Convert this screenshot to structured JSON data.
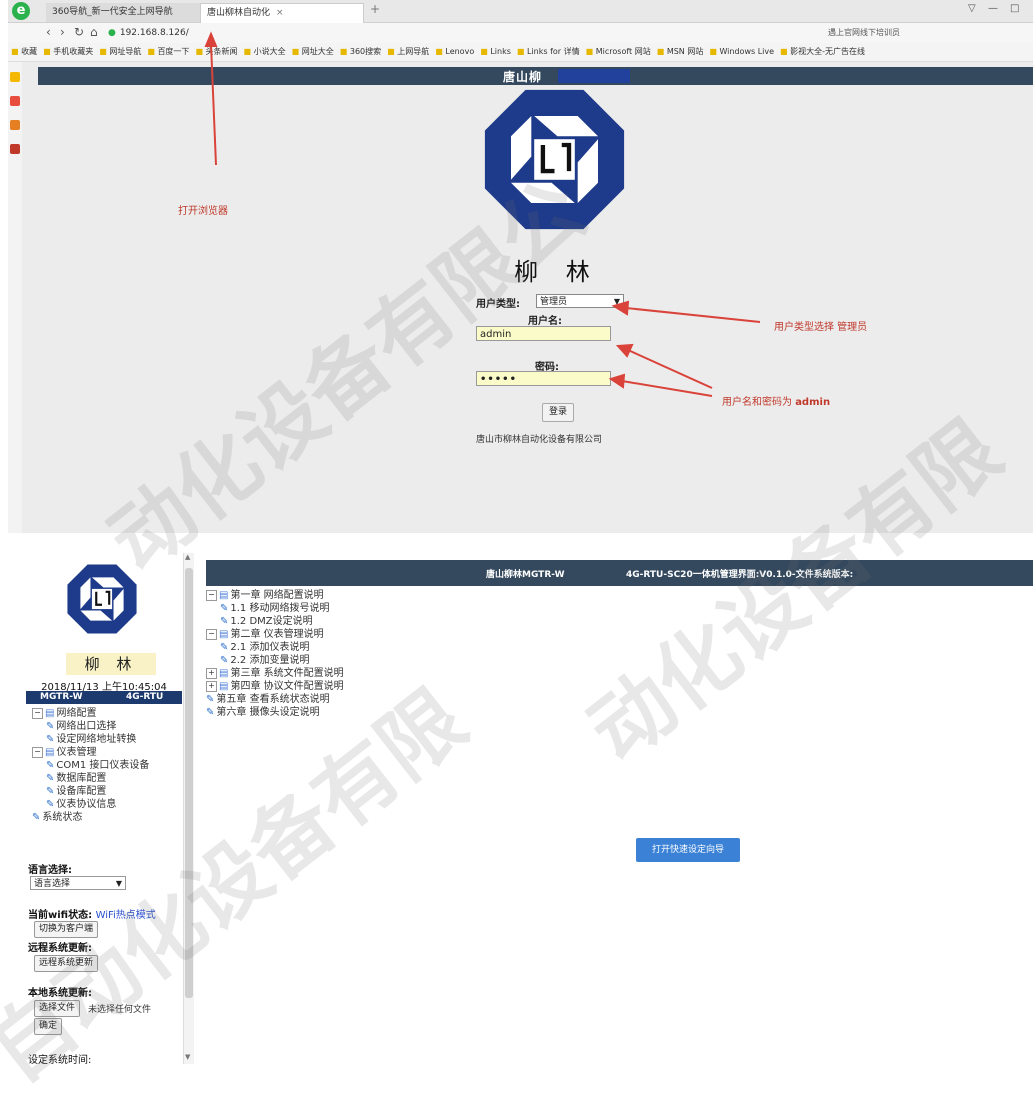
{
  "browser": {
    "tabs": [
      {
        "label": "360导航_新一代安全上网导航"
      },
      {
        "label": "唐山柳林自动化"
      }
    ],
    "new_tab_symbol": "+",
    "window_controls": [
      "▽",
      "—",
      "□"
    ],
    "url": "192.168.8.126/",
    "right_text": "遇上官网线下培训员"
  },
  "bookmarks": [
    "收藏",
    "手机收藏夹",
    "网址导航",
    "百度一下",
    "头条新闻",
    "小说大全",
    "网址大全",
    "360搜索",
    "上网导航",
    "Lenovo",
    "Links",
    "Links for 详情",
    "Microsoft 网站",
    "MSN 网站",
    "Windows Live",
    "影视大全-无广告在线"
  ],
  "login_page": {
    "header_title": "唐山柳",
    "brand": "柳 林",
    "user_type_label": "用户类型:",
    "user_type_value": "管理员",
    "username_label": "用户名:",
    "username_value": "admin",
    "password_label": "密码:",
    "password_mask": "•••••",
    "login_button": "登录",
    "company": "唐山市柳林自动化设备有限公司"
  },
  "annotations": {
    "open_browser": "打开浏览器",
    "select_user_type": "用户类型选择 管理员",
    "credentials_prefix": "用户名和密码为 ",
    "credentials_value": "admin"
  },
  "admin_panel": {
    "brand": "柳 林",
    "datetime": "2018/11/13 上午10:45:04",
    "model_left": "MGTR-W",
    "model_right": "4G-RTU",
    "sidebar_tree": [
      {
        "label": "网络配置",
        "level": 0,
        "type": "folder"
      },
      {
        "label": "网络出口选择",
        "level": 1,
        "type": "leaf"
      },
      {
        "label": "设定网络地址转换",
        "level": 1,
        "type": "leaf"
      },
      {
        "label": "仪表管理",
        "level": 0,
        "type": "folder"
      },
      {
        "label": "COM1 接口仪表设备",
        "level": 1,
        "type": "leaf"
      },
      {
        "label": "数据库配置",
        "level": 1,
        "type": "leaf"
      },
      {
        "label": "设备库配置",
        "level": 1,
        "type": "leaf"
      },
      {
        "label": "仪表协议信息",
        "level": 1,
        "type": "leaf"
      },
      {
        "label": "系统状态",
        "level": 0,
        "type": "leaf"
      }
    ],
    "lang_label": "语言选择:",
    "lang_value": "语言选择",
    "wifi_label": "当前wifi状态:",
    "wifi_value": "WiFi热点模式",
    "switch_client_btn": "切换为客户端",
    "remote_update_label": "远程系统更新:",
    "remote_update_btn": "远程系统更新",
    "local_update_label": "本地系统更新:",
    "choose_file_btn": "选择文件",
    "no_file_text": "未选择任何文件",
    "confirm_btn": "确定",
    "more_label": "设定系统时间:",
    "header_left": "唐山柳林MGTR-W",
    "header_right": "4G-RTU-SC20一体机管理界面:V0.1.0-文件系统版本:",
    "doc_tree": [
      {
        "label": "第一章 网络配置说明",
        "level": 0,
        "type": "folder",
        "toggle": "⊟"
      },
      {
        "label": "1.1 移动网络拨号说明",
        "level": 1,
        "type": "leaf"
      },
      {
        "label": "1.2 DMZ设定说明",
        "level": 1,
        "type": "leaf"
      },
      {
        "label": "第二章 仪表管理说明",
        "level": 0,
        "type": "folder",
        "toggle": "⊟"
      },
      {
        "label": "2.1 添加仪表说明",
        "level": 1,
        "type": "leaf"
      },
      {
        "label": "2.2 添加变量说明",
        "level": 1,
        "type": "leaf"
      },
      {
        "label": "第三章 系统文件配置说明",
        "level": 0,
        "type": "folder",
        "toggle": "⊞"
      },
      {
        "label": "第四章 协议文件配置说明",
        "level": 0,
        "type": "folder",
        "toggle": "⊞"
      },
      {
        "label": "第五章 查看系统状态说明",
        "level": 0,
        "type": "leaf"
      },
      {
        "label": "第六章 摄像头设定说明",
        "level": 0,
        "type": "leaf"
      }
    ],
    "wizard_btn": "打开快速设定向导"
  },
  "watermark": {
    "text_a": "动化设备有限公",
    "text_b": "动化设备有限",
    "text_c": "自动化设备有限"
  },
  "colors": {
    "header_navy": "#34495e",
    "logo_blue": "#1e3a8a",
    "annotation_red": "#c0392b",
    "input_yellow": "#fafbc8",
    "wizard_blue": "#3b82d6"
  }
}
